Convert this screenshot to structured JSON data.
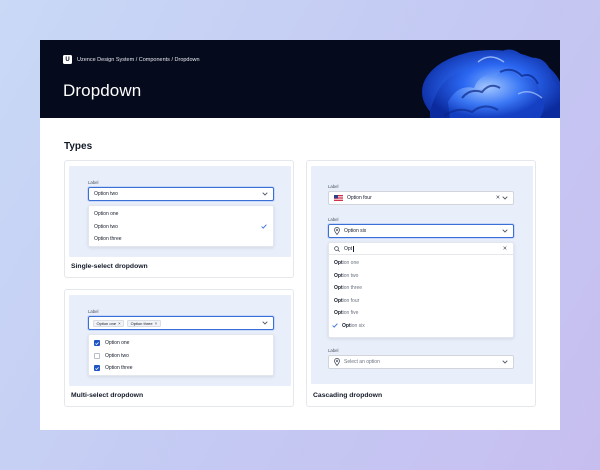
{
  "header": {
    "logo_letter": "U",
    "breadcrumb": "Uzence Design System / Components / Dropdown",
    "title": "Dropdown"
  },
  "section": {
    "title": "Types"
  },
  "single_select": {
    "label": "Label",
    "value": "Option two",
    "options": [
      {
        "label": "Option one",
        "selected": false
      },
      {
        "label": "Option two",
        "selected": true
      },
      {
        "label": "Option three",
        "selected": false
      }
    ],
    "caption": "Single-select dropdown"
  },
  "multi_select": {
    "label": "Label",
    "tags": [
      "Option one",
      "Option three"
    ],
    "tag_remove_glyph": "×",
    "options": [
      {
        "label": "Option one",
        "checked": true
      },
      {
        "label": "Option two",
        "checked": false
      },
      {
        "label": "Option three",
        "checked": true
      }
    ],
    "caption": "Multi-select dropdown"
  },
  "cascading": {
    "field1": {
      "label": "Label",
      "value": "Option four",
      "clear_glyph": "×"
    },
    "field2": {
      "label": "Label",
      "value": "Option six",
      "search": {
        "value": "Opt",
        "clear_glyph": "×"
      },
      "options": [
        {
          "match": "Opt",
          "rest": "ion one",
          "selected": false
        },
        {
          "match": "Opt",
          "rest": "ion two",
          "selected": false
        },
        {
          "match": "Opt",
          "rest": "ion three",
          "selected": false
        },
        {
          "match": "Opt",
          "rest": "ion four",
          "selected": false
        },
        {
          "match": "Opt",
          "rest": "ion five",
          "selected": false
        },
        {
          "match": "Opt",
          "rest": "ion six",
          "selected": true
        }
      ]
    },
    "field3": {
      "label": "Label",
      "placeholder": "Select an option"
    },
    "caption": "Cascading dropdown"
  },
  "colors": {
    "hero_bg": "#050a1c",
    "accent": "#3b6fd8",
    "checkbox_fill": "#1f54c4",
    "card_inner_bg": "#e8eefa",
    "blob_blue": "#1e5bf0"
  },
  "icons": {
    "chevron": "chevron-down-icon",
    "check": "check-icon",
    "flag": "us-flag-icon",
    "location": "location-pin-icon",
    "search": "search-icon",
    "clear": "close-icon"
  }
}
